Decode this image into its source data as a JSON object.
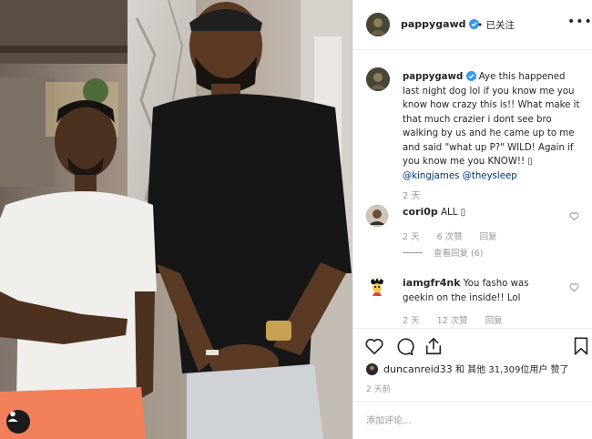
{
  "post": {
    "username": "pappygawd",
    "follow_state": "已关注",
    "more_label": "•••",
    "caption_text": "Aye this happened last night dog lol if you know me you know how crazy this is!! What make it that much crazier i dont see bro walking by us and he came up to me and said \"what up P?\" WILD! Again if you know me you KNOW!! ▯",
    "mentions": [
      "@kingjames",
      "@theysleep"
    ],
    "caption_time": "2 天"
  },
  "comments": [
    {
      "username": "cori0p",
      "text": "ALL ▯",
      "time": "2 天",
      "likes": "6 次赞",
      "reply": "回复",
      "view_replies": "查看回复 (6)"
    },
    {
      "username": "iamgfr4nk",
      "text": "You fasho was geekin on the inside!! Lol",
      "time": "2 天",
      "likes": "12 次赞",
      "reply": "回复"
    }
  ],
  "likes": {
    "liker": "duncanreid33",
    "joiner": "和 其他",
    "count": "31,309",
    "suffix": "位用户 赞了"
  },
  "post_time": "2 天前",
  "add_comment_placeholder": "添加评论...",
  "icons": {
    "like": "heart-icon",
    "comment": "comment-icon",
    "share": "share-icon",
    "save": "bookmark-icon",
    "verified": "verified-badge-icon",
    "tagged_user": "user-icon"
  },
  "colors": {
    "verified_blue": "#3897f0",
    "mention": "#003569",
    "muted": "#999999"
  }
}
